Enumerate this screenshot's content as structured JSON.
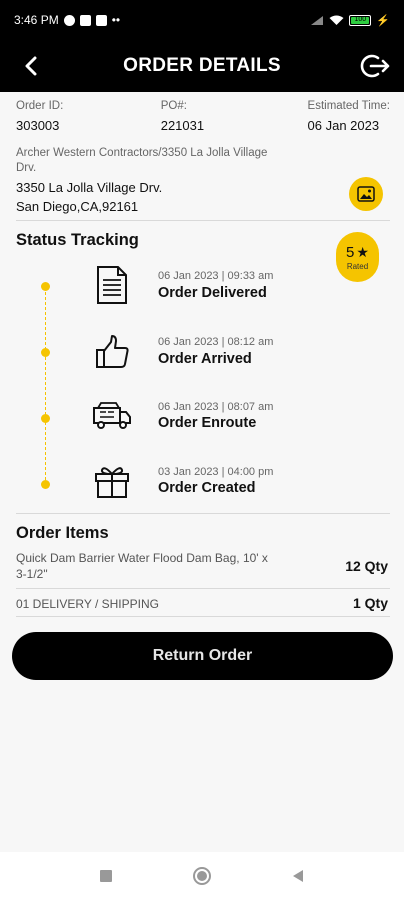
{
  "status_bar": {
    "time": "3:46 PM",
    "more": "••",
    "battery": "100"
  },
  "header": {
    "title": "ORDER DETAILS",
    "back_icon": "chevron-left-icon",
    "logout_icon": "logout-icon"
  },
  "order": {
    "id_label": "Order ID:",
    "id_value": "303003",
    "po_label": "PO#:",
    "po_value": "221031",
    "est_label": "Estimated Time:",
    "est_value": "06 Jan 2023",
    "company": "Archer Western Contractors/3350 La Jolla Village Drv.",
    "address_line1": "3350 La Jolla Village Drv.",
    "address_line2": "San Diego,CA,92161"
  },
  "status_tracking": {
    "title": "Status Tracking",
    "rating_value": "5",
    "rating_label": "Rated",
    "steps": [
      {
        "time": "06 Jan 2023 | 09:33 am",
        "status": "Order Delivered",
        "icon": "document-icon"
      },
      {
        "time": "06 Jan 2023 | 08:12 am",
        "status": "Order Arrived",
        "icon": "thumbs-up-icon"
      },
      {
        "time": "06 Jan 2023 | 08:07 am",
        "status": "Order Enroute",
        "icon": "truck-icon"
      },
      {
        "time": "03 Jan 2023 | 04:00 pm",
        "status": "Order Created",
        "icon": "gift-icon"
      }
    ]
  },
  "order_items": {
    "title": "Order Items",
    "items": [
      {
        "name_line1": "Quick Dam Barrier Water Flood Dam Bag, 10' x",
        "name_line2": "3-1/2\"",
        "qty": "12 Qty"
      },
      {
        "name_line1": "01 DELIVERY / SHIPPING",
        "qty": "1 Qty"
      }
    ]
  },
  "actions": {
    "return_label": "Return Order"
  },
  "colors": {
    "accent": "#f5c400",
    "header_bg": "#000000",
    "background": "#f7f7f7"
  }
}
